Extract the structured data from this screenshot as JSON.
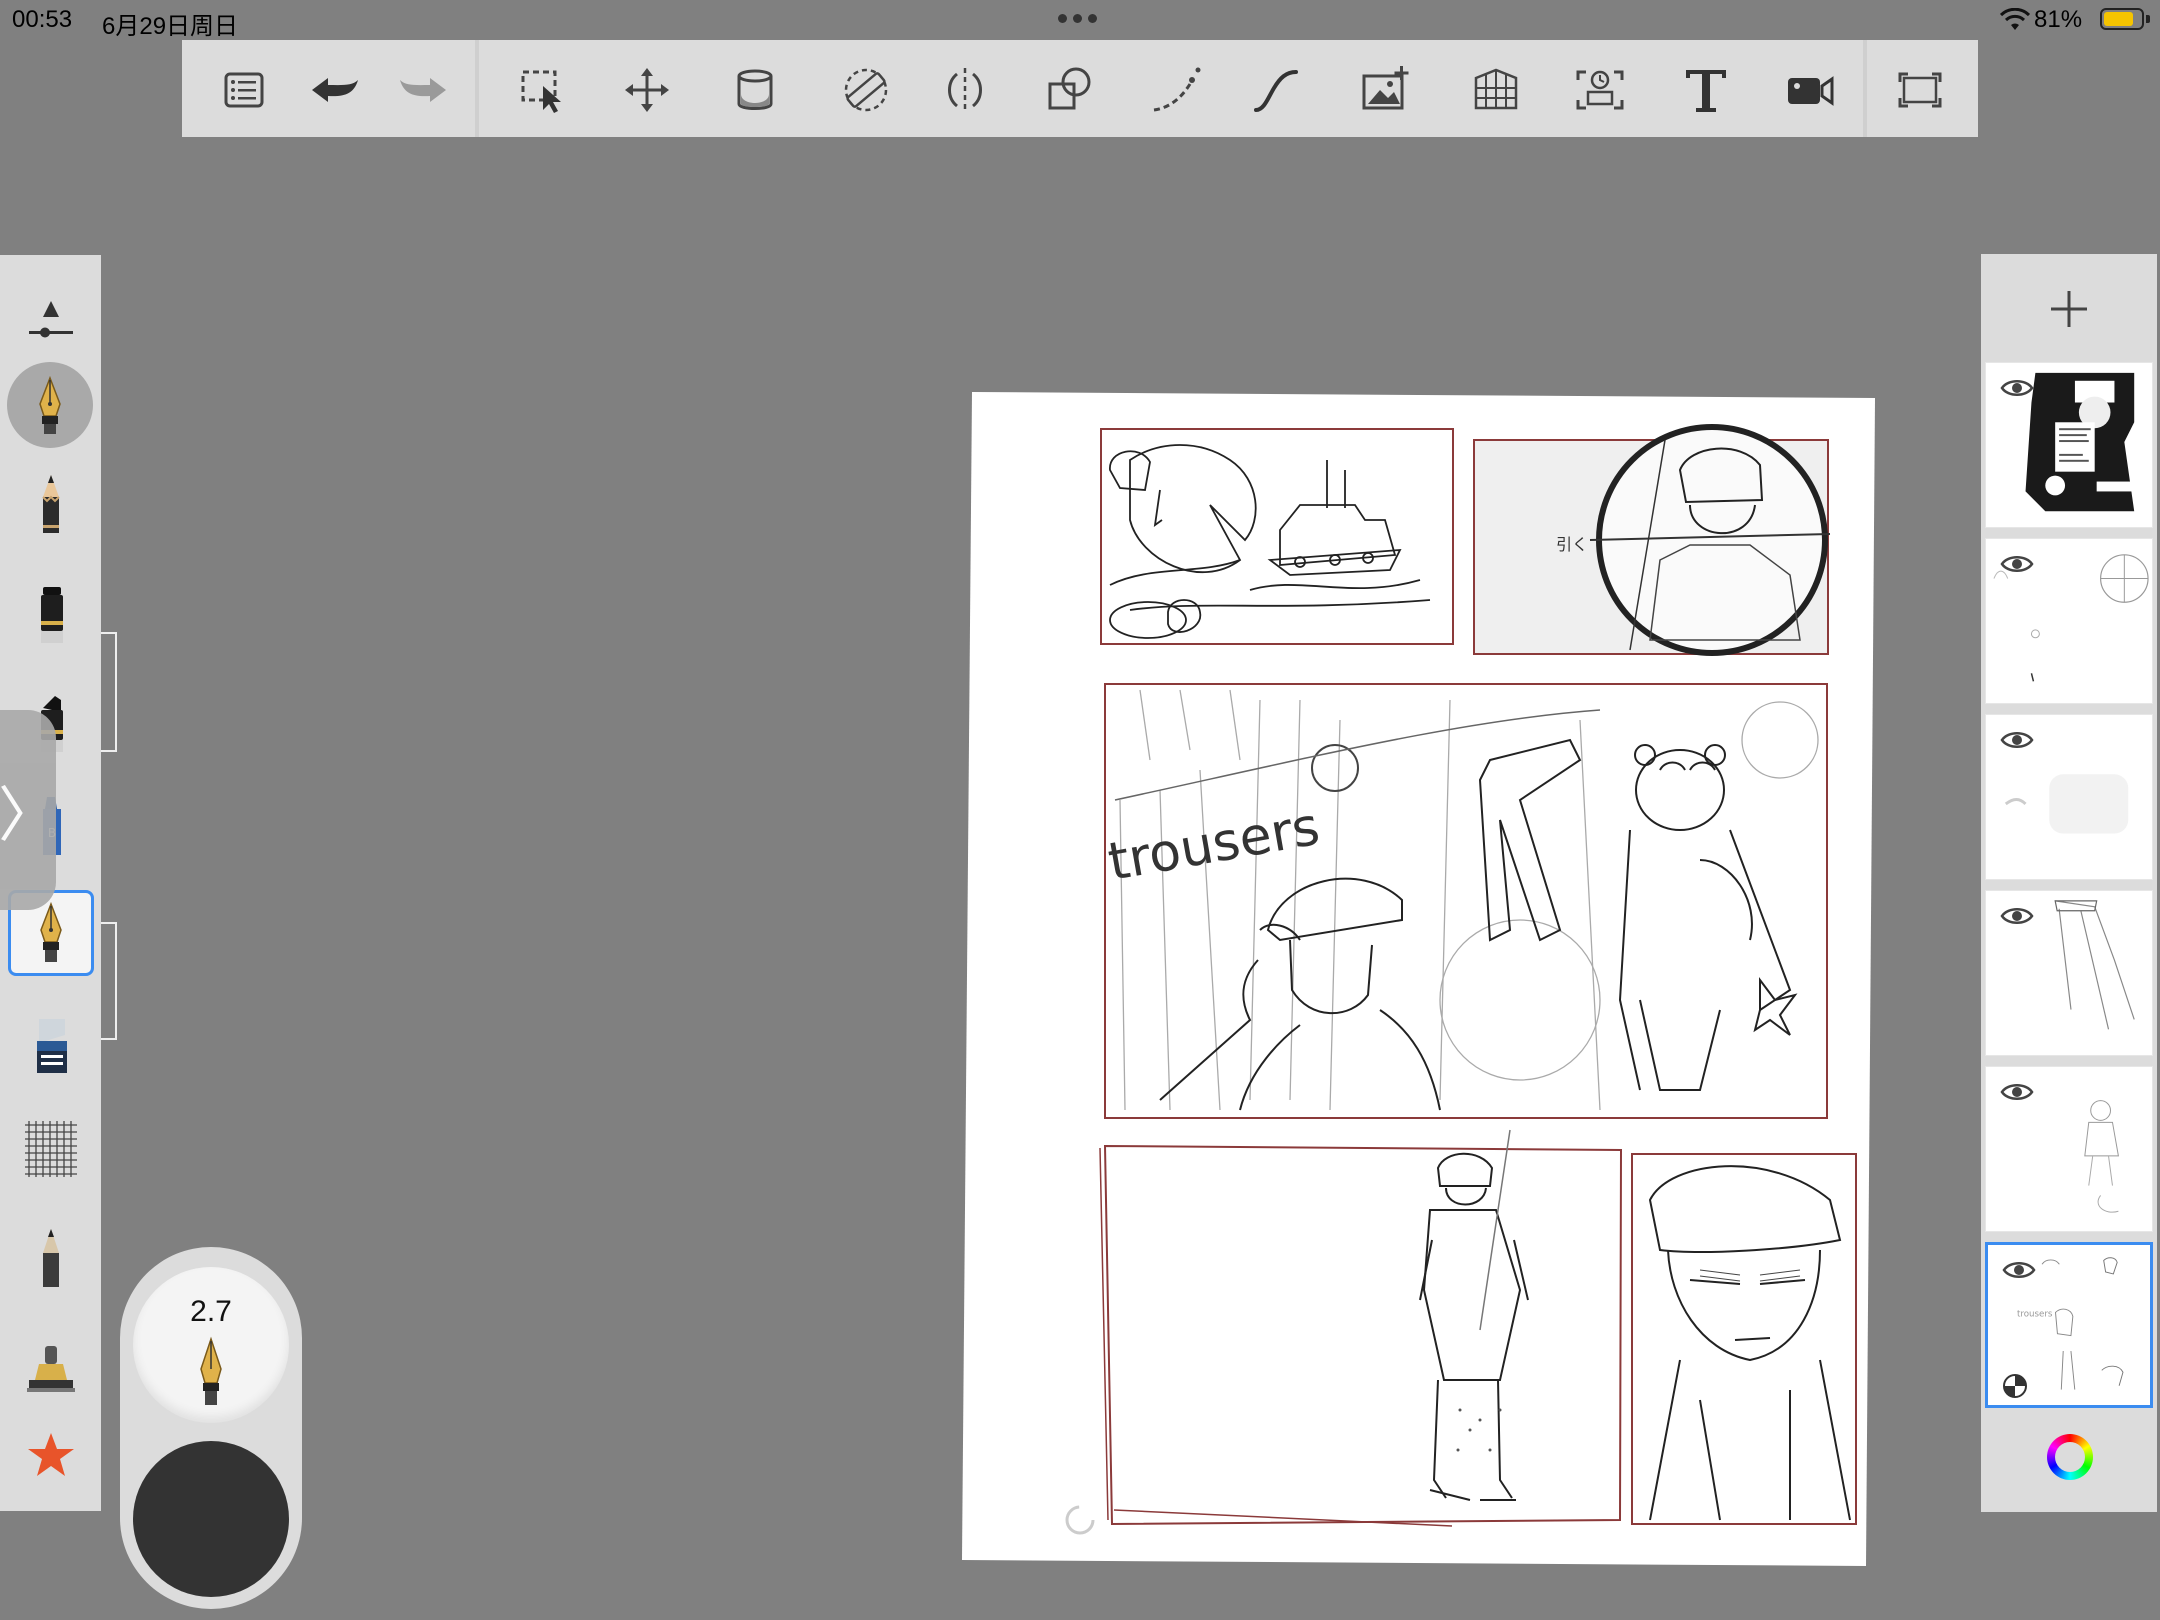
{
  "status_bar": {
    "time": "00:53",
    "date": "6月29日周日",
    "battery_percent": "81%",
    "battery_level": 0.81,
    "battery_color": "#f5c400"
  },
  "toolbar": {
    "items": [
      {
        "name": "gallery-list-button",
        "icon": "list-icon"
      },
      {
        "name": "undo-button",
        "icon": "undo-icon"
      },
      {
        "name": "redo-button",
        "icon": "redo-icon"
      },
      {
        "name": "selection-tool-button",
        "icon": "selection-icon"
      },
      {
        "name": "transform-tool-button",
        "icon": "move-arrows-icon"
      },
      {
        "name": "fill-tool-button",
        "icon": "paint-bucket-icon"
      },
      {
        "name": "ruler-tool-button",
        "icon": "ruler-icon"
      },
      {
        "name": "symmetry-tool-button",
        "icon": "symmetry-icon"
      },
      {
        "name": "shape-tool-button",
        "icon": "shapes-icon"
      },
      {
        "name": "stroke-tool-button",
        "icon": "curve-dots-icon"
      },
      {
        "name": "predictive-stroke-button",
        "icon": "s-curve-icon"
      },
      {
        "name": "import-image-button",
        "icon": "image-add-icon"
      },
      {
        "name": "perspective-grid-button",
        "icon": "perspective-grid-icon"
      },
      {
        "name": "timelapse-button",
        "icon": "timelapse-icon"
      },
      {
        "name": "text-tool-button",
        "icon": "text-icon"
      },
      {
        "name": "record-button",
        "icon": "video-camera-icon"
      },
      {
        "name": "fullscreen-button",
        "icon": "fullscreen-icon"
      }
    ]
  },
  "brush_panel": {
    "size_value": "2.7",
    "current_color": "#333333",
    "brushes": [
      {
        "name": "brush-properties-button",
        "icon": "brush-properties-icon"
      },
      {
        "name": "brush-ink-pen",
        "icon": "fountain-pen-icon",
        "selected": "circle"
      },
      {
        "name": "brush-pencil",
        "icon": "pencil-icon"
      },
      {
        "name": "brush-marker",
        "icon": "marker-icon"
      },
      {
        "name": "brush-chisel-marker",
        "icon": "chisel-marker-icon"
      },
      {
        "name": "brush-crayon",
        "icon": "crayon-icon"
      },
      {
        "name": "brush-fountain-pen",
        "icon": "fountain-pen-icon",
        "selected": "box"
      },
      {
        "name": "brush-eraser",
        "icon": "eraser-icon"
      },
      {
        "name": "brush-texture",
        "icon": "texture-grid-icon"
      },
      {
        "name": "brush-technical-pencil",
        "icon": "technical-pencil-icon"
      },
      {
        "name": "brush-stamp",
        "icon": "stamp-icon"
      },
      {
        "name": "brush-favorites",
        "icon": "star-icon"
      }
    ]
  },
  "layers_panel": {
    "add_label": "+",
    "layers": [
      {
        "name": "layer-1",
        "visible": true,
        "selected": false
      },
      {
        "name": "layer-2",
        "visible": true,
        "selected": false
      },
      {
        "name": "layer-3",
        "visible": true,
        "selected": false
      },
      {
        "name": "layer-4",
        "visible": true,
        "selected": false
      },
      {
        "name": "layer-5",
        "visible": true,
        "selected": false
      },
      {
        "name": "layer-6",
        "visible": true,
        "selected": true
      }
    ]
  },
  "canvas": {
    "sketch_text_1": "trousers",
    "sketch_text_2": "引く"
  },
  "colors": {
    "accent": "#3b8cf0",
    "panel_bg": "#dcdcdc",
    "workspace_bg": "#808080",
    "panel_border": "#8b3a3a",
    "favorite_star": "#e8542a"
  }
}
